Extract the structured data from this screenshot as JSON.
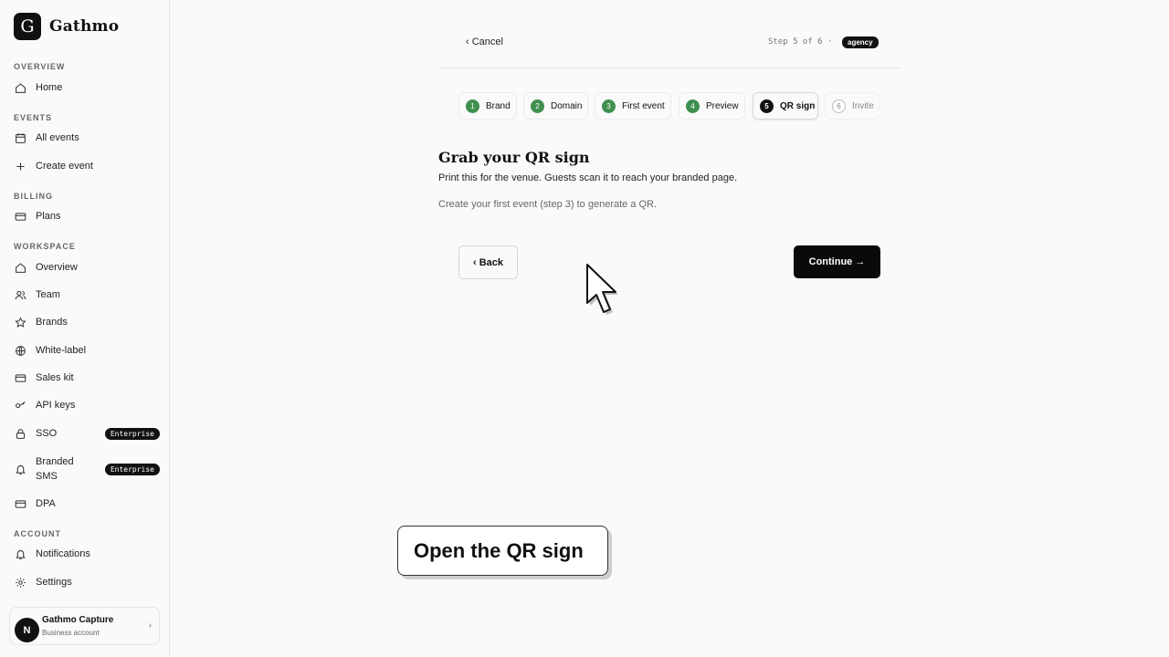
{
  "app": {
    "logo_letter": "G",
    "name": "Gathmo"
  },
  "sidebar": {
    "sections": {
      "overview": "OVERVIEW",
      "events": "EVENTS",
      "billing": "BILLING",
      "workspace": "WORKSPACE",
      "account": "ACCOUNT"
    },
    "items": {
      "home": "Home",
      "all_events": "All events",
      "create_event": "Create event",
      "plans": "Plans",
      "overview": "Overview",
      "team": "Team",
      "brands": "Brands",
      "white_label": "White-label",
      "sales_kit": "Sales kit",
      "api_keys": "API keys",
      "sso": "SSO",
      "branded_sms": "Branded SMS",
      "dpa": "DPA",
      "notifications": "Notifications",
      "settings": "Settings"
    },
    "enterprise_badge": "Enterprise",
    "account": {
      "avatar_letter": "N",
      "name": "Gathmo Capture",
      "type": "Business account",
      "chevron": "›"
    }
  },
  "header": {
    "cancel": "‹ Cancel",
    "step_text": "Step 5 of 6 ·",
    "plan_badge": "agency"
  },
  "steps": [
    {
      "num": "1",
      "label": "Brand",
      "state": "done"
    },
    {
      "num": "2",
      "label": "Domain",
      "state": "done"
    },
    {
      "num": "3",
      "label": "First event",
      "state": "done"
    },
    {
      "num": "4",
      "label": "Preview",
      "state": "done"
    },
    {
      "num": "5",
      "label": "QR sign",
      "state": "active"
    },
    {
      "num": "6",
      "label": "Invite",
      "state": "pending"
    }
  ],
  "content": {
    "title": "Grab your QR sign",
    "subtitle": "Print this for the venue. Guests scan it to reach your branded page.",
    "hint": "Create your first event (step 3) to generate a QR."
  },
  "buttons": {
    "back": "‹ Back",
    "continue": "Continue →"
  },
  "callout": "Open the QR sign",
  "colors": {
    "accent": "#111111",
    "step_done": "#3f8f4f"
  }
}
